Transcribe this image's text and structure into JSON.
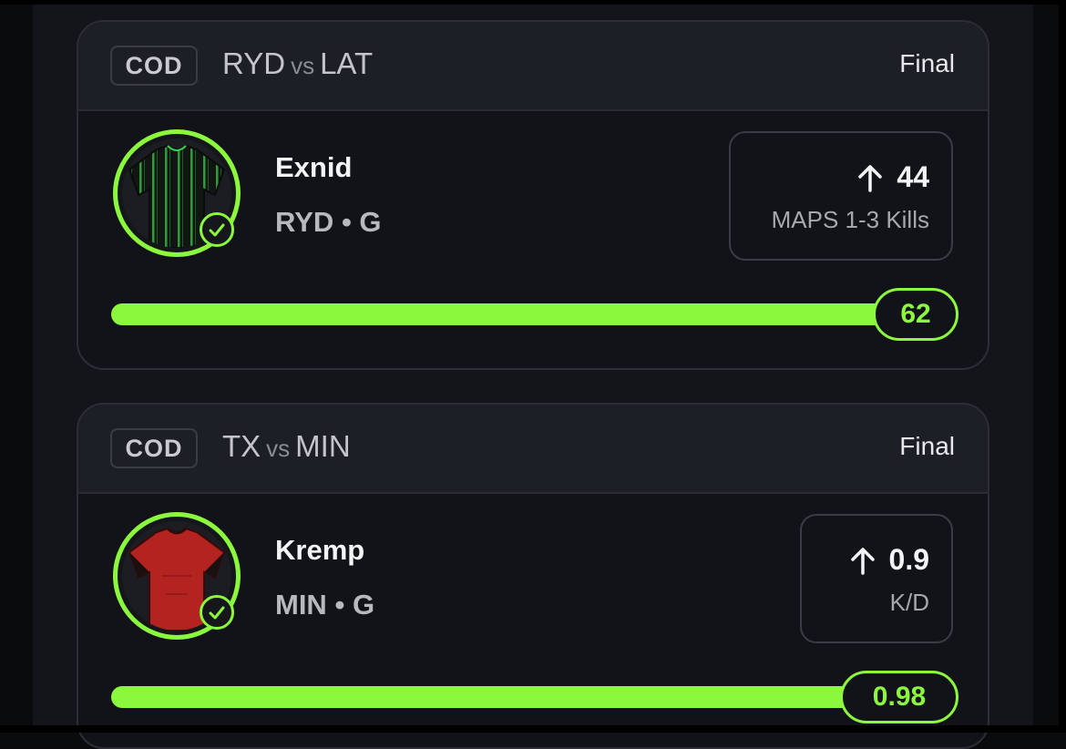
{
  "cards": [
    {
      "league": "COD",
      "team_a": "RYD",
      "vs": "vs",
      "team_b": "LAT",
      "status": "Final",
      "player": {
        "name": "Exnid",
        "team": "RYD",
        "separator": "•",
        "position": "G",
        "jersey": "green-striped-black-jersey"
      },
      "projection": {
        "direction": "up-arrow-icon",
        "line": "44",
        "stat": "MAPS 1-3 Kills"
      },
      "result": {
        "value": "62"
      }
    },
    {
      "league": "COD",
      "team_a": "TX",
      "vs": "vs",
      "team_b": "MIN",
      "status": "Final",
      "player": {
        "name": "Kremp",
        "team": "MIN",
        "separator": "•",
        "position": "G",
        "jersey": "red-jersey"
      },
      "projection": {
        "direction": "up-arrow-icon",
        "line": "0.9",
        "stat": "K/D"
      },
      "result": {
        "value": "0.98"
      }
    }
  ],
  "colors": {
    "accent": "#8cf83d",
    "card_bg": "#121319",
    "header_bg": "#1d1f26"
  }
}
